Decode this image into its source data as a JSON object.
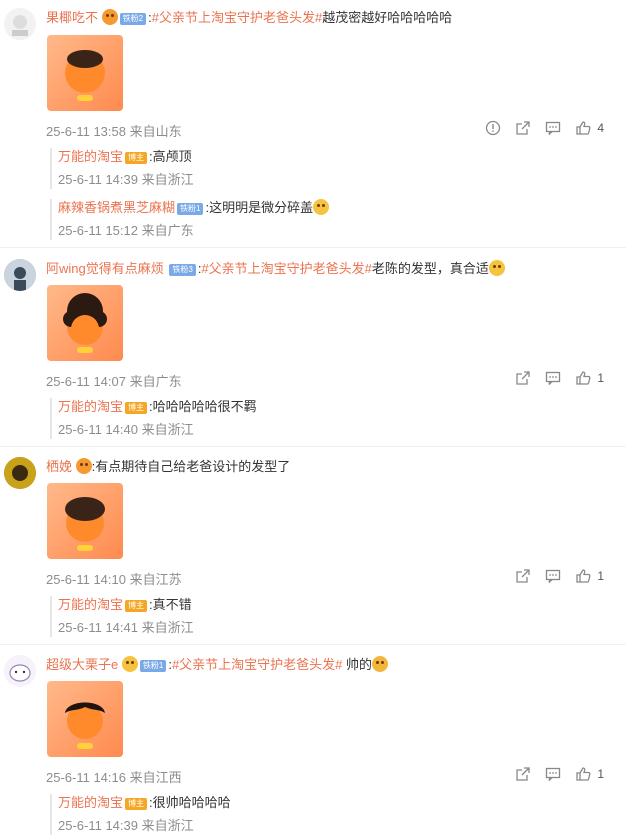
{
  "comments": [
    {
      "user": "果椰吃不",
      "fan_badge": "铁粉2",
      "topic": "#父亲节上淘宝守护老爸头发#",
      "text": "越茂密越好哈哈哈哈哈",
      "meta": "25-6-11 13:58 来自山东",
      "likes": "4",
      "replies": [
        {
          "user": "万能的淘宝",
          "badge": "博主",
          "text": ":高颅顶",
          "meta": "25-6-11 14:39 来自浙江"
        },
        {
          "user": "麻辣香锅煮黑芝麻糊",
          "badge": "铁粉1",
          "text": ":这明明是微分碎盖",
          "meta": "25-6-11 15:12 来自广东"
        }
      ]
    },
    {
      "user": "阿wing觉得有点麻烦",
      "fan_badge": "铁粉3",
      "topic": "#父亲节上淘宝守护老爸头发#",
      "text": "老陈的发型，真合适",
      "meta": "25-6-11 14:07 来自广东",
      "likes": "1",
      "replies": [
        {
          "user": "万能的淘宝",
          "badge": "博主",
          "text": ":哈哈哈哈哈很不羁",
          "meta": "25-6-11 14:40 来自浙江"
        }
      ]
    },
    {
      "user": "栖娩",
      "text": ":有点期待自己给老爸设计的发型了",
      "meta": "25-6-11 14:10 来自江苏",
      "likes": "1",
      "replies": [
        {
          "user": "万能的淘宝",
          "badge": "博主",
          "text": ":真不错",
          "meta": "25-6-11 14:41 来自浙江"
        }
      ]
    },
    {
      "user": "超级大栗子e",
      "fan_badge": "铁粉1",
      "topic": "#父亲节上淘宝守护老爸头发#",
      "text": " 帅的",
      "meta": "25-6-11 14:16 来自江西",
      "likes": "1",
      "replies": [
        {
          "user": "万能的淘宝",
          "badge": "博主",
          "text": ":很帅哈哈哈哈",
          "meta": "25-6-11 14:39 来自浙江"
        }
      ]
    }
  ],
  "colors": {
    "username": "#eb7350",
    "meta": "#8d8d8d",
    "fan_badge": "#7aa9e8",
    "boss_badge": "#f5a623"
  },
  "icons": [
    "report-icon",
    "share-icon",
    "comment-icon",
    "like-icon"
  ]
}
